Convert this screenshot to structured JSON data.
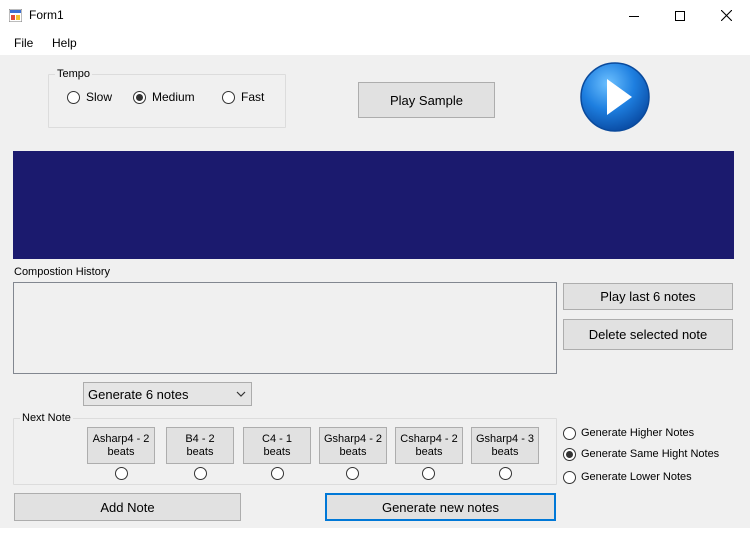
{
  "window": {
    "title": "Form1"
  },
  "menu": {
    "items": [
      "File",
      "Help"
    ]
  },
  "tempo": {
    "group_title": "Tempo",
    "options": [
      {
        "label": "Slow",
        "checked": false
      },
      {
        "label": "Medium",
        "checked": true
      },
      {
        "label": "Fast",
        "checked": false
      }
    ]
  },
  "play_sample_label": "Play Sample",
  "history": {
    "label": "Compostion History"
  },
  "actions": {
    "play_last_label": "Play last 6 notes",
    "delete_label": "Delete selected note"
  },
  "generate_combo": {
    "value": "Generate 6 notes"
  },
  "next_note": {
    "group_title": "Next Note",
    "notes": [
      {
        "line1": "Asharp4 - 2",
        "line2": "beats"
      },
      {
        "line1": "B4 - 2",
        "line2": "beats"
      },
      {
        "line1": "C4 - 1",
        "line2": "beats"
      },
      {
        "line1": "Gsharp4 - 2",
        "line2": "beats"
      },
      {
        "line1": "Csharp4 - 2",
        "line2": "beats"
      },
      {
        "line1": "Gsharp4 - 3",
        "line2": "beats"
      }
    ]
  },
  "pitch_options": [
    {
      "label": "Generate Higher Notes",
      "checked": false
    },
    {
      "label": "Generate Same Hight Notes",
      "checked": true
    },
    {
      "label": "Generate Lower Notes",
      "checked": false
    }
  ],
  "add_note_label": "Add Note",
  "generate_new_label": "Generate new notes",
  "icons": {
    "app": "form-app-icon",
    "minimize": "minimize-icon",
    "maximize": "maximize-icon",
    "close": "close-icon",
    "play": "play-icon",
    "dropdown": "chevron-down-icon"
  },
  "colors": {
    "display_panel": "#1b1a6e",
    "play_icon": "#1e7fe0",
    "focus_border": "#0078d7"
  }
}
